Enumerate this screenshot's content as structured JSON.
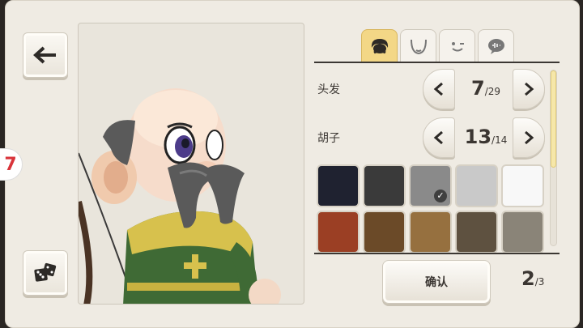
{
  "rows": [
    {
      "label": "头发",
      "current": "7",
      "total": "/29"
    },
    {
      "label": "胡子",
      "current": "13",
      "total": "/14"
    }
  ],
  "tabs": [
    {
      "icon": "hair-icon",
      "active": true
    },
    {
      "icon": "face-shape-icon",
      "active": false
    },
    {
      "icon": "expression-icon",
      "active": false
    },
    {
      "icon": "voice-bubble-icon",
      "active": false
    }
  ],
  "swatches": [
    {
      "color": "#1f2230",
      "selected": false
    },
    {
      "color": "#3a3a3a",
      "selected": false
    },
    {
      "color": "#8a8a8a",
      "selected": true
    },
    {
      "color": "#c9c9c9",
      "selected": false
    },
    {
      "color": "#f8f8f8",
      "selected": false
    },
    {
      "color": "#9b3f24",
      "selected": false
    },
    {
      "color": "#6b4a28",
      "selected": false
    },
    {
      "color": "#96703f",
      "selected": false
    },
    {
      "color": "#5e5140",
      "selected": false
    },
    {
      "color": "#8a8478",
      "selected": false
    }
  ],
  "confirm_label": "确认",
  "page": {
    "current": "2",
    "total": "/3"
  },
  "side_badge": "7"
}
